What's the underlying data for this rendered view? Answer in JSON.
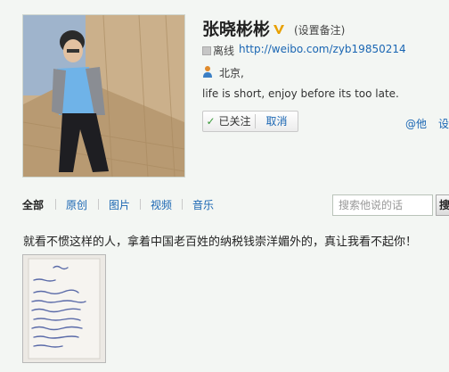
{
  "profile": {
    "name": "张晓彬彬",
    "verified_icon": "v-verified-icon",
    "remark_label": "(设置备注)",
    "status": "离线",
    "url": "http://weibo.com/zyb19850214",
    "location": "北京,",
    "bio": "life is short, enjoy before its too late.",
    "followed_label": "已关注",
    "cancel_label": "取消",
    "at_label": "@他",
    "more_label": "设"
  },
  "tabs": [
    {
      "label": "全部"
    },
    {
      "label": "原创"
    },
    {
      "label": "图片"
    },
    {
      "label": "视频"
    },
    {
      "label": "音乐"
    }
  ],
  "search": {
    "placeholder": "搜索他说的话",
    "button_label": "搜"
  },
  "post": {
    "text": "就看不惯这样的人，拿着中国老百姓的纳税钱崇洋媚外的，真让我看不起你！"
  },
  "colors": {
    "background": "#f3f6f3",
    "link": "#1a66b3",
    "verified": "#e8a000"
  }
}
